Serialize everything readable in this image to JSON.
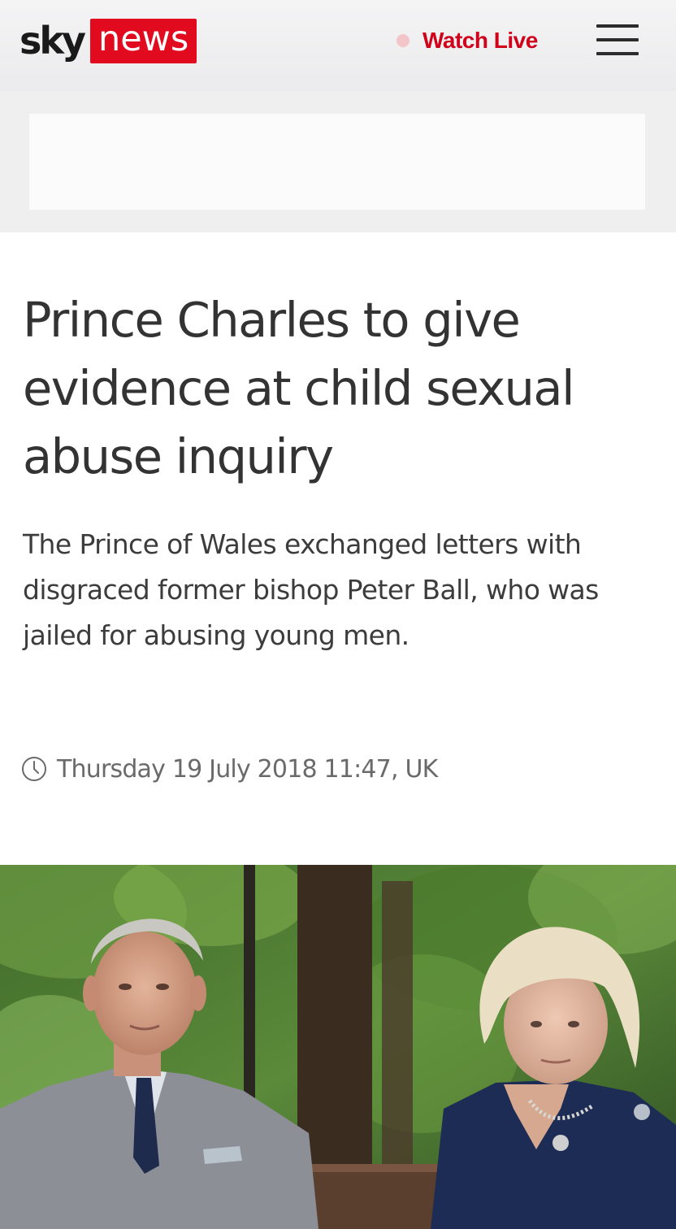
{
  "header": {
    "logo_sky": "sky",
    "logo_news": "news",
    "watch_live_label": "Watch Live",
    "live_dot_color": "#f3c5c9",
    "brand_red": "#e10a1e",
    "menu_icon": "hamburger-menu-icon"
  },
  "article": {
    "headline": "Prince Charles to give evidence at child sexual abuse inquiry",
    "standfirst": "The Prince of Wales exchanged letters with disgraced former bishop Peter Ball, who was jailed for abusing young men.",
    "timestamp": "Thursday 19 July 2018 11:47, UK",
    "timestamp_icon": "clock-icon"
  }
}
